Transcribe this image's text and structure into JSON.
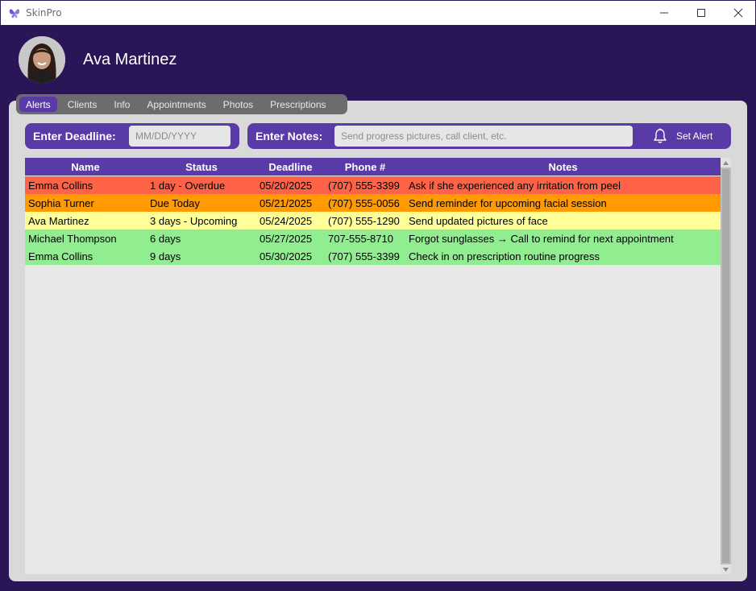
{
  "window": {
    "title": "SkinPro",
    "icon": "butterfly-icon"
  },
  "profile": {
    "name": "Ava Martinez",
    "avatar": "avatar-photo"
  },
  "tabs": [
    {
      "label": "Alerts",
      "active": true
    },
    {
      "label": "Clients",
      "active": false
    },
    {
      "label": "Info",
      "active": false
    },
    {
      "label": "Appointments",
      "active": false
    },
    {
      "label": "Photos",
      "active": false
    },
    {
      "label": "Prescriptions",
      "active": false
    }
  ],
  "deadline": {
    "label": "Enter Deadline:",
    "placeholder": "MM/DD/YYYY",
    "value": ""
  },
  "notes": {
    "label": "Enter Notes:",
    "placeholder": "Send progress pictures, call client, etc.",
    "value": ""
  },
  "set_alert": {
    "label": "Set Alert",
    "icon": "bell-icon"
  },
  "table": {
    "headers": {
      "name": "Name",
      "status": "Status",
      "deadline": "Deadline",
      "phone": "Phone #",
      "notes": "Notes"
    },
    "rows": [
      {
        "name": "Emma Collins",
        "status": "1 day - Overdue",
        "deadline": "05/20/2025",
        "phone": "(707) 555-3399",
        "notes": "Ask if she experienced any irritation from peel",
        "color": "#ff6347"
      },
      {
        "name": "Sophia Turner",
        "status": "Due Today",
        "deadline": "05/21/2025",
        "phone": "(707) 555-0056",
        "notes": "Send reminder for upcoming facial session",
        "color": "#ff9a00"
      },
      {
        "name": "Ava Martinez",
        "status": "3 days - Upcoming",
        "deadline": "05/24/2025",
        "phone": "(707) 555-1290",
        "notes": "Send updated pictures of face",
        "color": "#ffff99"
      },
      {
        "name": "Michael Thompson",
        "status": "6 days",
        "deadline": "05/27/2025",
        "phone": "707-555-8710",
        "notes": "Forgot sunglasses → Call to remind for next appointment",
        "color": "#90ee90"
      },
      {
        "name": "Emma Collins",
        "status": "9 days",
        "deadline": "05/30/2025",
        "phone": "(707) 555-3399",
        "notes": "Check in on prescription routine progress",
        "color": "#90ee90"
      }
    ]
  },
  "colors": {
    "background": "#2a1656",
    "accent": "#5a3aa6",
    "panel": "#d9d9d9",
    "tabbar": "#6c6c6c"
  }
}
